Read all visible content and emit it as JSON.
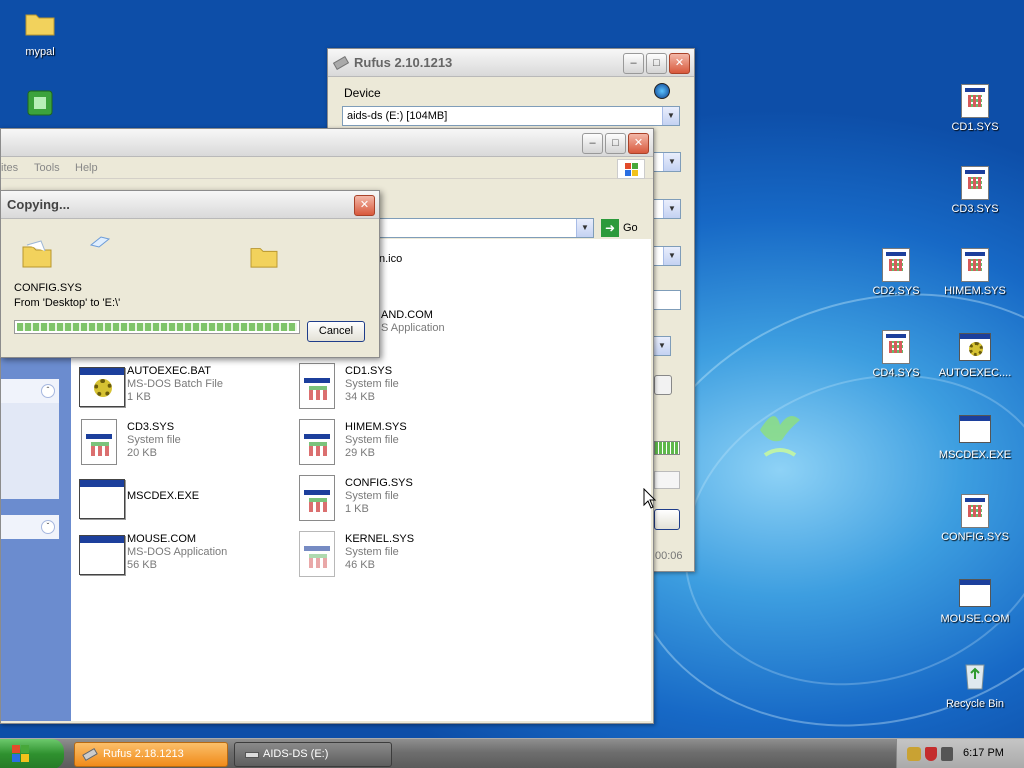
{
  "desktop": {
    "left_icons": [
      {
        "label": "mypal",
        "icon": "folder-icon"
      },
      {
        "label": "",
        "icon": "shortcut-icon"
      }
    ],
    "right_icons": [
      {
        "label": "CD1.SYS"
      },
      {
        "label": "CD3.SYS"
      },
      {
        "label": "CD2.SYS"
      },
      {
        "label": "HIMEM.SYS"
      },
      {
        "label": "CD4.SYS"
      },
      {
        "label": "AUTOEXEC...."
      },
      {
        "label": "MSCDEX.EXE"
      },
      {
        "label": "CONFIG.SYS"
      },
      {
        "label": "MOUSE.COM"
      },
      {
        "label": "Recycle Bin"
      }
    ]
  },
  "rufus": {
    "title": "Rufus 2.10.1213",
    "device_label": "Device",
    "device_value": "aids-ds (E:) [104MB]",
    "timer_partial": "00:06"
  },
  "explorer": {
    "menu": [
      "ites",
      "Tools",
      "Help"
    ],
    "go_label": "Go",
    "partial_files": [
      {
        "name": "n.ico"
      },
      {
        "name": "AND.COM",
        "type": "S Application"
      }
    ],
    "files": [
      {
        "name": "AUTOEXEC.BAT",
        "type": "MS-DOS Batch File",
        "size": "1 KB",
        "icon": "batch-file-icon"
      },
      {
        "name": "CD1.SYS",
        "type": "System file",
        "size": "34 KB",
        "icon": "system-file-icon"
      },
      {
        "name": "CD3.SYS",
        "type": "System file",
        "size": "20 KB",
        "icon": "system-file-icon"
      },
      {
        "name": "HIMEM.SYS",
        "type": "System file",
        "size": "29 KB",
        "icon": "system-file-icon"
      },
      {
        "name": "MSCDEX.EXE",
        "type": "",
        "size": "",
        "icon": "application-icon"
      },
      {
        "name": "CONFIG.SYS",
        "type": "System file",
        "size": "1 KB",
        "icon": "system-file-icon"
      },
      {
        "name": "MOUSE.COM",
        "type": "MS-DOS Application",
        "size": "56 KB",
        "icon": "application-icon"
      },
      {
        "name": "KERNEL.SYS",
        "type": "System file",
        "size": "46 KB",
        "icon": "system-file-icon"
      }
    ]
  },
  "copy_dialog": {
    "title": "Copying...",
    "file_name": "CONFIG.SYS",
    "from_to": "From 'Desktop' to 'E:\\'",
    "progress": 1.0,
    "cancel_label": "Cancel"
  },
  "taskbar": {
    "tasks": [
      {
        "label": "Rufus 2.18.1213"
      },
      {
        "label": "AIDS-DS (E:)"
      }
    ],
    "clock": "6:17 PM"
  }
}
